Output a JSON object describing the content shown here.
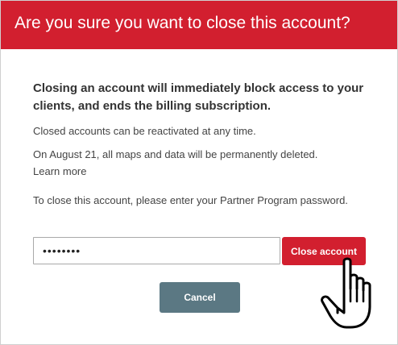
{
  "dialog": {
    "title": "Are you sure you want to close this account?",
    "warning": "Closing an account will immediately block access to your clients, and ends the billing subscription.",
    "info_reactivate": "Closed accounts can be reactivated at any time.",
    "info_deletion": "On August 21, all maps and data will be permanently deleted.",
    "learn_more": "Learn more",
    "info_password": "To close this account, please enter your Partner Program password.",
    "password_value": "12345678",
    "close_button": "Close account",
    "cancel_button": "Cancel",
    "cursor_icon": "hand-pointer-icon"
  },
  "colors": {
    "header": "#d21f2f",
    "danger_button": "#d21f2f",
    "cancel_button": "#5b7883"
  }
}
